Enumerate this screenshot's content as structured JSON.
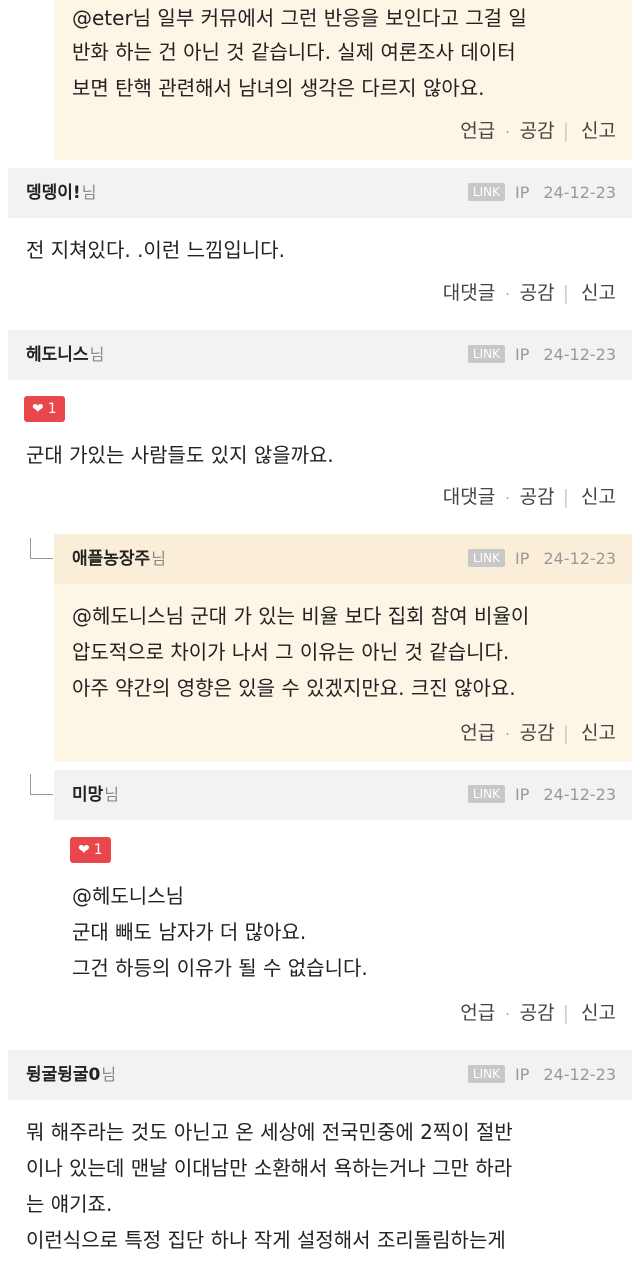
{
  "comments": [
    {
      "lines": [
        "@eter님 일부 커뮤에서 그런 반응을 보인다고 그걸 일",
        "반화 하는 건 아닌 것 같습니다. 실제 여론조사 데이터",
        "보면 탄핵 관련해서 남녀의 생각은 다르지 않아요."
      ],
      "actions": {
        "reply": "언급",
        "sep": "·",
        "like": "공감",
        "bar": "|",
        "report": "신고"
      }
    },
    {
      "nick": "뎅뎅이!",
      "suffix": "님",
      "link": "LINK",
      "ip": "IP",
      "date": "24-12-23",
      "lines": [
        "전 지쳐있다. .이런 느낌입니다."
      ],
      "actions": {
        "reply": "대댓글",
        "sep": "·",
        "like": "공감",
        "bar": "|",
        "report": "신고"
      }
    },
    {
      "nick": "헤도니스",
      "suffix": "님",
      "link": "LINK",
      "ip": "IP",
      "date": "24-12-23",
      "heart_icon": "heart-icon",
      "likes": "1",
      "lines": [
        "군대 가있는 사람들도 있지 않을까요."
      ],
      "actions": {
        "reply": "대댓글",
        "sep": "·",
        "like": "공감",
        "bar": "|",
        "report": "신고"
      }
    },
    {
      "nick": "애플농장주",
      "suffix": "님",
      "link": "LINK",
      "ip": "IP",
      "date": "24-12-23",
      "lines": [
        "@헤도니스님 군대 가 있는 비율 보다 집회 참여 비율이",
        "압도적으로 차이가 나서 그 이유는 아닌 것 같습니다.",
        "아주 약간의 영향은 있을 수 있겠지만요. 크진 않아요."
      ],
      "actions": {
        "reply": "언급",
        "sep": "·",
        "like": "공감",
        "bar": "|",
        "report": "신고"
      }
    },
    {
      "nick": "미망",
      "suffix": "님",
      "link": "LINK",
      "ip": "IP",
      "date": "24-12-23",
      "heart_icon": "heart-icon",
      "likes": "1",
      "lines": [
        "@헤도니스님",
        "군대 빼도 남자가 더 많아요.",
        "그건 하등의 이유가 될 수 없습니다."
      ],
      "actions": {
        "reply": "언급",
        "sep": "·",
        "like": "공감",
        "bar": "|",
        "report": "신고"
      }
    },
    {
      "nick": "뒹굴뒹굴0",
      "suffix": "님",
      "link": "LINK",
      "ip": "IP",
      "date": "24-12-23",
      "lines": [
        "뭐 해주라는 것도 아닌고 온 세상에 전국민중에 2찍이 절반",
        "이나 있는데 맨날 이대남만 소환해서 욕하는거나 그만 하라",
        "는 얘기죠.",
        "이런식으로 특정 집단 하나 작게 설정해서 조리돌림하는게"
      ]
    }
  ]
}
